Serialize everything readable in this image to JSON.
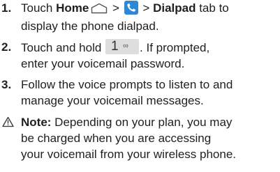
{
  "steps": [
    {
      "number": "1.",
      "line1_pre": "Touch ",
      "home_label": "Home",
      "sep1": " > ",
      "sep2": " > ",
      "dialpad_label": "Dialpad",
      "line1_post": " tab to",
      "line2": "display the phone dialpad."
    },
    {
      "number": "2.",
      "line1_pre": "Touch and hold ",
      "key_digit": "1",
      "key_symbol": "∞",
      "line1_post": ". If prompted,",
      "line2": "enter your voicemail password."
    },
    {
      "number": "3.",
      "line1": "Follow the voice prompts to listen to and",
      "line2": "manage your voicemail messages."
    }
  ],
  "note": {
    "label": "Note:",
    "line1": " Depending on your plan, you may",
    "line2": "be charged when you are accessing",
    "line3": "your voicemail from your wireless phone."
  },
  "icons": {
    "home": "home-icon",
    "phone": "phone-app-icon",
    "warning": "warning-icon",
    "phone_color": "#2e86d6"
  }
}
